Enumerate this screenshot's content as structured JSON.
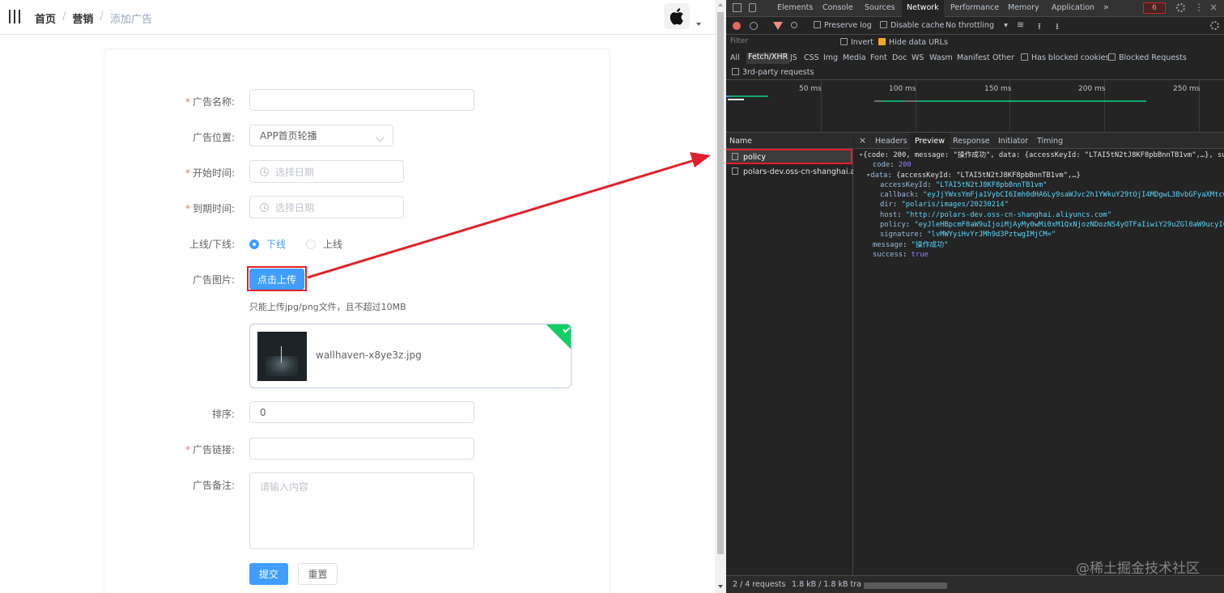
{
  "breadcrumb": {
    "home": "首页",
    "marketing": "营销",
    "current": "添加广告",
    "sep": "/"
  },
  "form": {
    "name_label": "广告名称:",
    "position_label": "广告位置:",
    "position_value": "APP首页轮播",
    "start_label": "开始时间:",
    "start_placeholder": "选择日期",
    "end_label": "到期时间:",
    "end_placeholder": "选择日期",
    "status_label": "上线/下线:",
    "status_off": "下线",
    "status_on": "上线",
    "image_label": "广告图片:",
    "upload_button": "点击上传",
    "upload_tip": "只能上传jpg/png文件，且不超过10MB",
    "file_name": "wallhaven-x8ye3z.jpg",
    "sort_label": "排序:",
    "sort_value": "0",
    "link_label": "广告链接:",
    "note_label": "广告备注:",
    "note_placeholder": "请输入内容",
    "submit": "提交",
    "reset": "重置",
    "required_mark": "*"
  },
  "devtools": {
    "tabs": [
      "Elements",
      "Console",
      "Sources",
      "Network",
      "Performance",
      "Memory",
      "Application"
    ],
    "more": "»",
    "issues_count": "6",
    "preserve_log": "Preserve log",
    "disable_cache": "Disable cache",
    "throttling": "No throttling",
    "filter_placeholder": "Filter",
    "invert": "Invert",
    "hide_data_urls": "Hide data URLs",
    "filter_types": [
      "All",
      "Fetch/XHR",
      "JS",
      "CSS",
      "Img",
      "Media",
      "Font",
      "Doc",
      "WS",
      "Wasm",
      "Manifest",
      "Other"
    ],
    "has_blocked_cookies": "Has blocked cookies",
    "blocked_requests": "Blocked Requests",
    "third_party": "3rd-party requests",
    "ticks": [
      "50 ms",
      "100 ms",
      "150 ms",
      "200 ms",
      "250 ms"
    ],
    "name_header": "Name",
    "requests": [
      "policy",
      "polars-dev.oss-cn-shanghai.al..."
    ],
    "preview_tabs": [
      "Headers",
      "Preview",
      "Response",
      "Initiator",
      "Timing"
    ],
    "close": "×",
    "status_requests": "2 / 4 requests",
    "status_size": "1.8 kB / 1.8 kB tra",
    "json": {
      "summary": "{code: 200, message: \"操作成功\", data: {accessKeyId: \"LTAI5tN2tJ8KF8pbBnnTB1vm\",…}, su",
      "code": "200",
      "data_summary": "{accessKeyId: \"LTAI5tN2tJ8KF8pbBnnTB1vm\",…}",
      "accessKeyId": "\"LTAI5tN2tJ8KF8pbBnnTB1vm\"",
      "callback": "\"eyJjYWxsYmFja1VybCI6Imh0dHA6Ly9saWJvc2h1YWkuY29tOjI4MDgwL3BvbGFyaXMtcG",
      "dir": "\"polaris/images/20230214\"",
      "host": "\"http://polars-dev.oss-cn-shanghai.aliyuncs.com\"",
      "policy": "\"eyJleHBpcmF0aW9uIjoiMjAyMy0wMi0xM1QxNjozNDozNS4yOTFaIiwiY29uZGl0aW9ucyI6W",
      "signature": "\"lvMWYyiHvYrJMh9d3PztwgIMjCM=\"",
      "message": "\"操作成功\"",
      "success": "true"
    }
  },
  "watermark": "@稀土掘金技术社区",
  "colors": {
    "primary": "#409eff",
    "highlight": "#e0212b",
    "success": "#13ce66"
  }
}
